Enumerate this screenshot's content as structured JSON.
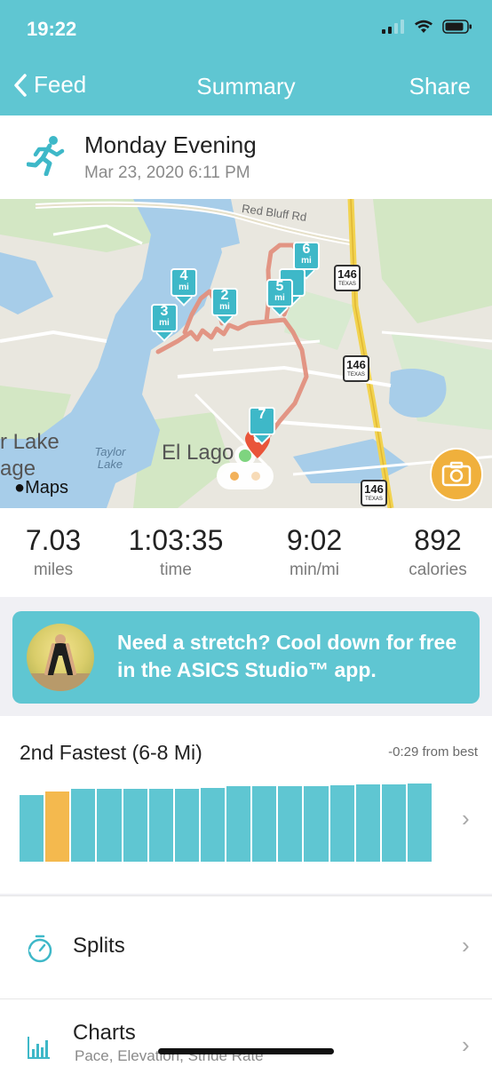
{
  "status_bar": {
    "time": "19:22"
  },
  "nav": {
    "back_label": "Feed",
    "title": "Summary",
    "share_label": "Share"
  },
  "activity": {
    "title": "Monday Evening",
    "datetime": "Mar 23, 2020 6:11 PM"
  },
  "map": {
    "labels": {
      "road": "Red Bluff Rd",
      "lake_name": "Taylor Lake",
      "lake_partial_1": "r Lake",
      "lake_partial_2": "age",
      "town": "El Lago",
      "attribution": "Maps"
    },
    "highway_number": "146",
    "highway_state": "TEXAS",
    "mile_markers": [
      {
        "num": "2",
        "unit": "mi"
      },
      {
        "num": "3",
        "unit": "mi"
      },
      {
        "num": "4",
        "unit": "mi"
      },
      {
        "num": "5",
        "unit": "mi"
      },
      {
        "num": "6",
        "unit": "mi"
      },
      {
        "num": "7",
        "unit": ""
      }
    ],
    "route_color": "#e2907e"
  },
  "stats": [
    {
      "value": "7.03",
      "unit": "miles"
    },
    {
      "value": "1:03:35",
      "unit": "time"
    },
    {
      "value": "9:02",
      "unit": "min/mi"
    },
    {
      "value": "892",
      "unit": "calories"
    }
  ],
  "promo": {
    "text": "Need a stretch? Cool down for free in the ASICS Studio™ app."
  },
  "performance": {
    "title": "2nd Fastest (6-8 Mi)",
    "delta": "-0:29 from best",
    "highlight_index": 1,
    "bar_color": "#5fc6d2",
    "highlight_color": "#f4b94e",
    "bar_levels": [
      0.8,
      0.84,
      0.87,
      0.87,
      0.87,
      0.87,
      0.87,
      0.88,
      0.9,
      0.9,
      0.9,
      0.9,
      0.92,
      0.93,
      0.93,
      0.94
    ]
  },
  "rows": {
    "splits_label": "Splits",
    "charts_label": "Charts",
    "charts_sub": "Pace, Elevation, Stride Rate"
  },
  "colors": {
    "brand": "#5fc6d2",
    "camera": "#f0b03c",
    "pin": "#3eb8c8"
  }
}
